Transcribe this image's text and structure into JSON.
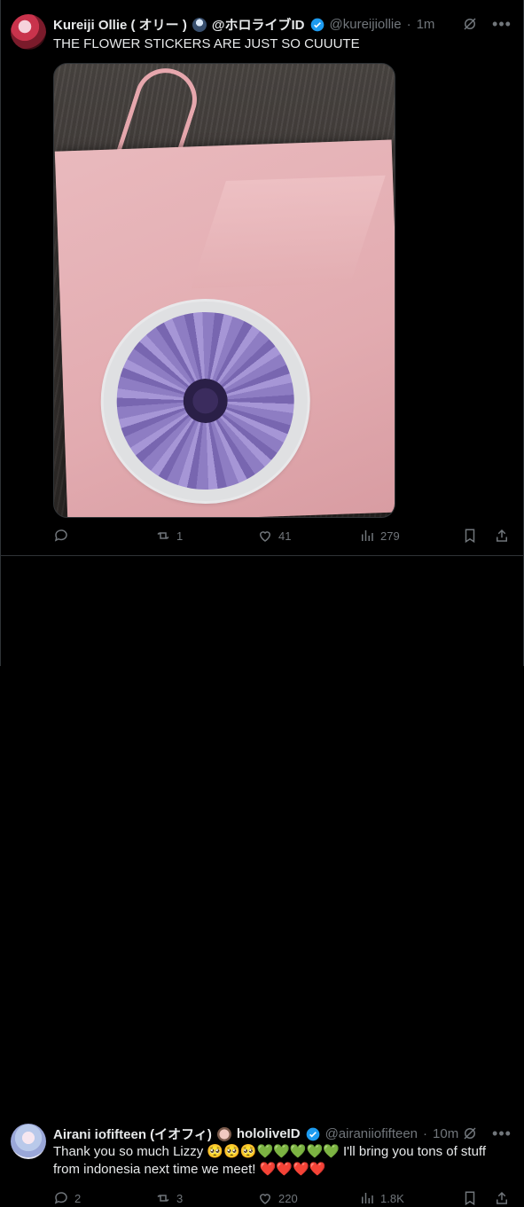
{
  "tweets": [
    {
      "author_name": "Kureiji Ollie ( オリー )",
      "author_suffix": "@ホロライブID",
      "handle": "@kureijiollie",
      "time": "1m",
      "text": "THE FLOWER STICKERS ARE JUST SO CUUUTE",
      "stats": {
        "replies": "",
        "reposts": "1",
        "likes": "41",
        "views": "279"
      }
    },
    {
      "author_name": "Airani iofifteen (イオフィ)",
      "author_suffix": "hololiveID",
      "handle": "@airaniiofifteen",
      "time": "10m",
      "text": "Thank you so much Lizzy 🥺🥺🥺💚💚💚💚💚 I'll bring you tons of stuff from indonesia next time we meet! ❤️❤️❤️❤️",
      "stats": {
        "replies": "2",
        "reposts": "3",
        "likes": "220",
        "views": "1.8K"
      }
    }
  ],
  "separator": "·",
  "colors": {
    "background": "#000000",
    "text": "#e7e9ea",
    "muted": "#71767b",
    "verified": "#1d9bf0",
    "border": "#2f3336"
  },
  "icons": [
    "grok-icon",
    "more-icon",
    "reply-icon",
    "repost-icon",
    "like-icon",
    "views-icon",
    "bookmark-icon",
    "share-icon",
    "verified-badge-icon"
  ]
}
